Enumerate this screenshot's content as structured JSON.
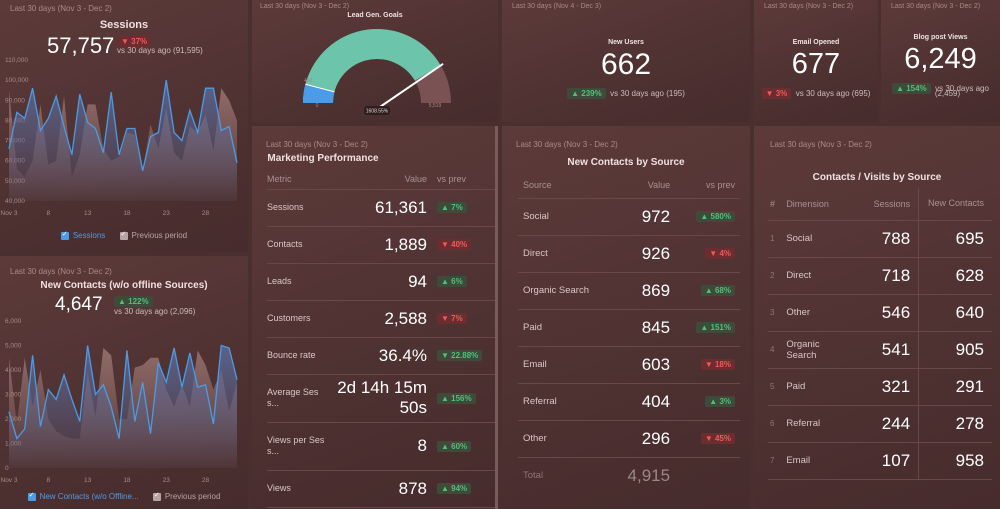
{
  "sessions": {
    "period": "Last 30 days (Nov 3 - Dec 2)",
    "title": "Sessions",
    "value": "57,757",
    "change": "▼ 37%",
    "change_dir": "down",
    "comparison": "vs 30 days ago (91,595)",
    "legend": [
      "Sessions",
      "Previous period"
    ]
  },
  "new_contacts": {
    "period": "Last 30 days (Nov 3 - Dec 2)",
    "title": "New Contacts (w/o offline Sources)",
    "value": "4,647",
    "change": "▲ 122%",
    "change_dir": "up",
    "comparison": "vs 30 days ago (2,096)",
    "legend": [
      "New Contacts (w/o Offline...",
      "Previous period"
    ]
  },
  "lead_gen": {
    "period": "Last 30 days (Nov 3 - Dec 2)",
    "title": "Lead Gen. Goals",
    "min_label": "0",
    "max_label": "5,519",
    "target_label": "450",
    "value_label": "1608.55%",
    "target_fraction": 0.0815,
    "value_fraction": 0.83
  },
  "new_users": {
    "period": "Last 30 days (Nov 4 - Dec 3)",
    "title": "New Users",
    "value": "662",
    "change": "▲ 239%",
    "comparison": "vs 30 days ago (195)"
  },
  "email_opened": {
    "period": "Last 30 days (Nov 3 - Dec 2)",
    "title": "Email Opened",
    "value": "677",
    "change": "▼ 3%",
    "comparison": "vs 30 days ago (695)"
  },
  "blog_views": {
    "period": "Last 30 days (Nov 3 - Dec 2)",
    "title": "Blog post Views",
    "value": "6,249",
    "change": "▲ 154%",
    "comparison_1": "vs 30 days ago",
    "comparison_2": "(2,459)"
  },
  "marketing": {
    "period": "Last 30 days (Nov 3 - Dec 2)",
    "title": "Marketing Performance",
    "headers": [
      "Metric",
      "Value",
      "vs prev"
    ],
    "rows": [
      {
        "metric": "Sessions",
        "value": "61,361",
        "change": "▲ 7%",
        "dir": "up"
      },
      {
        "metric": "Contacts",
        "value": "1,889",
        "change": "▼ 40%",
        "dir": "down"
      },
      {
        "metric": "Leads",
        "value": "94",
        "change": "▲ 6%",
        "dir": "up"
      },
      {
        "metric": "Customers",
        "value": "2,588",
        "change": "▼ 7%",
        "dir": "down"
      },
      {
        "metric": "Bounce rate",
        "value": "36.4%",
        "change": "▼ 22.88%",
        "dir": "up"
      },
      {
        "metric": "Average Sess...",
        "value": "2d 14h 15m 50s",
        "change": "▲ 156%",
        "dir": "up"
      },
      {
        "metric": "Views per Sess...",
        "value": "8",
        "change": "▲ 60%",
        "dir": "up"
      },
      {
        "metric": "Views",
        "value": "878",
        "change": "▲ 94%",
        "dir": "up"
      }
    ]
  },
  "contacts_by_source": {
    "period": "Last 30 days (Nov 3 - Dec 2)",
    "title": "New Contacts by Source",
    "headers": [
      "Source",
      "Value",
      "vs prev"
    ],
    "rows": [
      {
        "source": "Social",
        "value": "972",
        "change": "▲ 580%",
        "dir": "up"
      },
      {
        "source": "Direct",
        "value": "926",
        "change": "▼ 4%",
        "dir": "down"
      },
      {
        "source": "Organic Search",
        "value": "869",
        "change": "▲ 68%",
        "dir": "up"
      },
      {
        "source": "Paid",
        "value": "845",
        "change": "▲ 151%",
        "dir": "up"
      },
      {
        "source": "Email",
        "value": "603",
        "change": "▼ 18%",
        "dir": "down"
      },
      {
        "source": "Referral",
        "value": "404",
        "change": "▲ 3%",
        "dir": "up"
      },
      {
        "source": "Other",
        "value": "296",
        "change": "▼ 45%",
        "dir": "down"
      }
    ],
    "total_label": "Total",
    "total_value": "4,915"
  },
  "visits_by_source": {
    "period": "Last 30 days (Nov 3 - Dec 2)",
    "title": "Contacts / Visits by Source",
    "headers": [
      "#",
      "Dimension",
      "Sessions",
      "New Contacts"
    ],
    "rows": [
      {
        "n": "1",
        "dim": "Social",
        "sessions": "788",
        "contacts": "695"
      },
      {
        "n": "2",
        "dim": "Direct",
        "sessions": "718",
        "contacts": "628"
      },
      {
        "n": "3",
        "dim": "Other",
        "sessions": "546",
        "contacts": "640"
      },
      {
        "n": "4",
        "dim": "Organic Search",
        "sessions": "541",
        "contacts": "905"
      },
      {
        "n": "5",
        "dim": "Paid",
        "sessions": "321",
        "contacts": "291"
      },
      {
        "n": "6",
        "dim": "Referral",
        "sessions": "244",
        "contacts": "278"
      },
      {
        "n": "7",
        "dim": "Email",
        "sessions": "107",
        "contacts": "958"
      }
    ]
  },
  "chart_data": [
    {
      "type": "area",
      "title": "Sessions",
      "ylim": [
        40000,
        110000
      ],
      "yticks": [
        "110,000",
        "100,000",
        "90,000",
        "80,000",
        "70,000",
        "60,000",
        "50,000",
        "40,000"
      ],
      "xticks": [
        "Nov 3",
        "8",
        "13",
        "18",
        "23",
        "28"
      ],
      "series": [
        {
          "name": "Sessions",
          "color": "#4a9be8",
          "values": [
            66000,
            84000,
            81000,
            96000,
            75000,
            81000,
            92000,
            77000,
            63000,
            93000,
            79000,
            76000,
            64000,
            94000,
            63000,
            76000,
            76000,
            55000,
            72000,
            74000,
            100000,
            74000,
            70000,
            85000,
            74000,
            96000,
            96000,
            75000,
            77000,
            59000
          ]
        },
        {
          "name": "Previous period",
          "color": "#8a6664",
          "values": [
            95000,
            56000,
            52000,
            60000,
            88000,
            58000,
            60000,
            92000,
            52000,
            63000,
            88000,
            88000,
            66000,
            60000,
            62000,
            74000,
            73000,
            55000,
            78000,
            66000,
            86000,
            64000,
            60000,
            77000,
            74000,
            83000,
            65000,
            96000,
            90000,
            80000
          ]
        }
      ]
    },
    {
      "type": "area",
      "title": "New Contacts (w/o offline Sources)",
      "ylim": [
        0,
        6000
      ],
      "yticks": [
        "6,000",
        "5,000",
        "4,000",
        "3,000",
        "2,000",
        "1,000",
        "0"
      ],
      "xticks": [
        "Nov 3",
        "8",
        "13",
        "18",
        "23",
        "28"
      ],
      "series": [
        {
          "name": "New Contacts (w/o Offline...",
          "color": "#4a9be8",
          "values": [
            2300,
            1200,
            1600,
            4600,
            1700,
            3200,
            2800,
            3800,
            2800,
            1900,
            5000,
            3000,
            3400,
            2500,
            1200,
            4800,
            1900,
            3500,
            1400,
            4300,
            3500,
            4900,
            3300,
            4700,
            3300,
            3400,
            1800,
            5000,
            4900,
            3600
          ]
        },
        {
          "name": "Previous period",
          "color": "#8a6664",
          "values": [
            4500,
            1800,
            4500,
            2500,
            4000,
            2000,
            1500,
            1300,
            1200,
            1200,
            3900,
            2100,
            4900,
            4600,
            2000,
            2000,
            4100,
            4200,
            4500,
            4500,
            3200,
            2500,
            3400,
            2500,
            4800,
            4200,
            3200,
            4000,
            2300,
            3500
          ]
        }
      ]
    }
  ]
}
